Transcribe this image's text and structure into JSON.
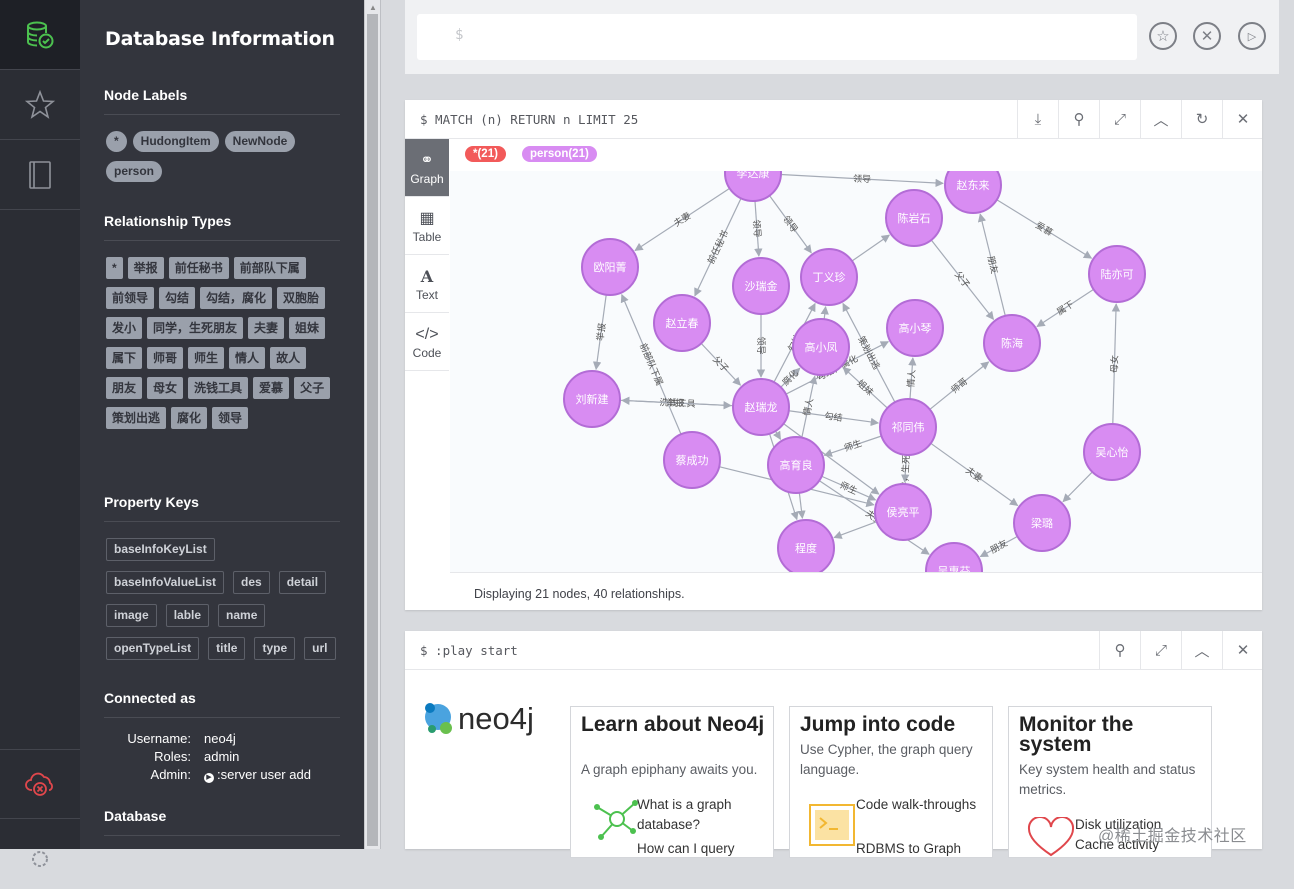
{
  "sidebar": {
    "title": "Database Information",
    "node_labels_title": "Node Labels",
    "node_labels": [
      "*",
      "HudongItem",
      "NewNode",
      "person"
    ],
    "relationship_types_title": "Relationship Types",
    "relationship_types": [
      "*",
      "举报",
      "前任秘书",
      "前部队下属",
      "前领导",
      "勾结",
      "勾结，腐化",
      "双胞胎",
      "发小",
      "同学，生死朋友",
      "夫妻",
      "姐妹",
      "属下",
      "师哥",
      "师生",
      "情人",
      "故人",
      "朋友",
      "母女",
      "洗钱工具",
      "爱慕",
      "父子",
      "策划出逃",
      "腐化",
      "领导"
    ],
    "property_keys_title": "Property Keys",
    "property_keys": [
      "baseInfoKeyList",
      "baseInfoValueList",
      "des",
      "detail",
      "image",
      "lable",
      "name",
      "openTypeList",
      "title",
      "type",
      "url"
    ],
    "connected_title": "Connected as",
    "username_label": "Username:",
    "username": "neo4j",
    "roles_label": "Roles:",
    "roles": "admin",
    "admin_label": "Admin:",
    "admin_cmd": ":server user add",
    "database_title": "Database"
  },
  "editor": {
    "prompt": "$"
  },
  "query_frame": {
    "command": "$ MATCH (n) RETURN n LIMIT 25",
    "tabs": [
      "Graph",
      "Table",
      "Text",
      "Code"
    ],
    "legend_all": "*(21)",
    "legend_person": "person(21)",
    "status": "Displaying 21 nodes, 40 relationships.",
    "colors": {
      "node_fill": "#d88cf2",
      "node_stroke": "#b36cd6",
      "legend_all": "#f25a5a",
      "legend_person": "#d88cf2"
    },
    "nodes": [
      {
        "id": "lidakang",
        "label": "李达康"
      },
      {
        "id": "zhaodonglai",
        "label": "赵东来"
      },
      {
        "id": "ouyangjing",
        "label": "欧阳菁"
      },
      {
        "id": "chenyanshi",
        "label": "陈岩石"
      },
      {
        "id": "shaoruijin",
        "label": "沙瑞金"
      },
      {
        "id": "dingyizhen",
        "label": "丁义珍"
      },
      {
        "id": "luyike",
        "label": "陆亦可"
      },
      {
        "id": "zhaoiichun",
        "label": "赵立春"
      },
      {
        "id": "gaoxiaofeng",
        "label": "高小凤"
      },
      {
        "id": "gaoxiaoqin",
        "label": "高小琴"
      },
      {
        "id": "chenhai",
        "label": "陈海"
      },
      {
        "id": "liuxinjian",
        "label": "刘新建"
      },
      {
        "id": "zhaoruilong",
        "label": "赵瑞龙"
      },
      {
        "id": "qitongwei",
        "label": "祁同伟"
      },
      {
        "id": "caichenggong",
        "label": "蔡成功"
      },
      {
        "id": "gaoyuliang",
        "label": "高育良"
      },
      {
        "id": "wuxinyi",
        "label": "吴心怡"
      },
      {
        "id": "houliangping",
        "label": "侯亮平"
      },
      {
        "id": "lianglu",
        "label": "梁璐"
      },
      {
        "id": "chengdu",
        "label": "程度"
      },
      {
        "id": "wuhuifen",
        "label": "吴惠芬"
      }
    ],
    "edges": [
      {
        "from": "lidakang",
        "to": "zhaodonglai",
        "label": "领导"
      },
      {
        "from": "lidakang",
        "to": "ouyangjing",
        "label": "夫妻"
      },
      {
        "from": "lidakang",
        "to": "zhaoiichun",
        "label": "前任秘书"
      },
      {
        "from": "lidakang",
        "to": "shaoruijin",
        "label": "领导"
      },
      {
        "from": "lidakang",
        "to": "dingyizhen",
        "label": "领导"
      },
      {
        "from": "zhaodonglai",
        "to": "luyike",
        "label": "爱慕"
      },
      {
        "from": "chenhai",
        "to": "zhaodonglai",
        "label": "朋友"
      },
      {
        "from": "chenyanshi",
        "to": "chenhai",
        "label": "父子"
      },
      {
        "from": "dingyizhen",
        "to": "chenyanshi",
        "label": ""
      },
      {
        "from": "luyike",
        "to": "chenhai",
        "label": "属下"
      },
      {
        "from": "ouyangjing",
        "to": "liuxinjian",
        "label": "举报"
      },
      {
        "from": "zhaoiichun",
        "to": "zhaoruilong",
        "label": "父子"
      },
      {
        "from": "caichenggong",
        "to": "ouyangjing",
        "label": "前部队下属"
      },
      {
        "from": "zhaoruilong",
        "to": "liuxinjian",
        "label": "洗钱工具"
      },
      {
        "from": "liuxinjian",
        "to": "zhaoruilong",
        "label": "举报"
      },
      {
        "from": "zhaoruilong",
        "to": "gaoxiaofeng",
        "label": "腐化"
      },
      {
        "from": "zhaoruilong",
        "to": "gaoxiaoqin",
        "label": "勾结，腐化"
      },
      {
        "from": "zhaoruilong",
        "to": "dingyizhen",
        "label": "勾结"
      },
      {
        "from": "zhaoruilong",
        "to": "qitongwei",
        "label": "勾结"
      },
      {
        "from": "qitongwei",
        "to": "dingyizhen",
        "label": "策划出逃"
      },
      {
        "from": "qitongwei",
        "to": "gaoxiaoqin",
        "label": "情人"
      },
      {
        "from": "qitongwei",
        "to": "chenhai",
        "label": "师哥"
      },
      {
        "from": "qitongwei",
        "to": "houliangping",
        "label": "同学，生死朋友"
      },
      {
        "from": "qitongwei",
        "to": "lianglu",
        "label": "夫妻"
      },
      {
        "from": "qitongwei",
        "to": "gaoyuliang",
        "label": "师生"
      },
      {
        "from": "qitongwei",
        "to": "gaoxiaofeng",
        "label": "姐妹"
      },
      {
        "from": "gaoyuliang",
        "to": "gaoxiaofeng",
        "label": "情人"
      },
      {
        "from": "gaoyuliang",
        "to": "houliangping",
        "label": "师生"
      },
      {
        "from": "gaoyuliang",
        "to": "wuhuifen",
        "label": "夫妻"
      },
      {
        "from": "gaoyuliang",
        "to": "chengdu",
        "label": ""
      },
      {
        "from": "wuxinyi",
        "to": "luyike",
        "label": "母女"
      },
      {
        "from": "wuxinyi",
        "to": "lianglu",
        "label": ""
      },
      {
        "from": "lianglu",
        "to": "wuhuifen",
        "label": "朋友"
      },
      {
        "from": "caichenggong",
        "to": "houliangping",
        "label": ""
      },
      {
        "from": "shaoruijin",
        "to": "zhaoruilong",
        "label": "领导"
      },
      {
        "from": "zhaoruilong",
        "to": "gaoyuliang",
        "label": ""
      },
      {
        "from": "zhaoruilong",
        "to": "chengdu",
        "label": ""
      },
      {
        "from": "houliangping",
        "to": "chengdu",
        "label": ""
      },
      {
        "from": "zhaoruilong",
        "to": "houliangping",
        "label": ""
      },
      {
        "from": "gaoxiaofeng",
        "to": "dingyizhen",
        "label": ""
      }
    ]
  },
  "play_frame": {
    "command": "$ :play start",
    "logo_text": "neo4j",
    "cards": [
      {
        "title": "Learn about Neo4j",
        "subtitle": "A graph epiphany awaits you.",
        "link1": "What is a graph database?",
        "link2": "How can I query"
      },
      {
        "title": "Jump into code",
        "subtitle": "Use Cypher, the graph query language.",
        "link1": "Code walk-throughs",
        "link2": "RDBMS to Graph"
      },
      {
        "title": "Monitor the system",
        "subtitle": "Key system health and status metrics.",
        "link1": "Disk utilization",
        "link2": "Cache activity"
      }
    ]
  },
  "watermark": "@稀土掘金技术社区"
}
